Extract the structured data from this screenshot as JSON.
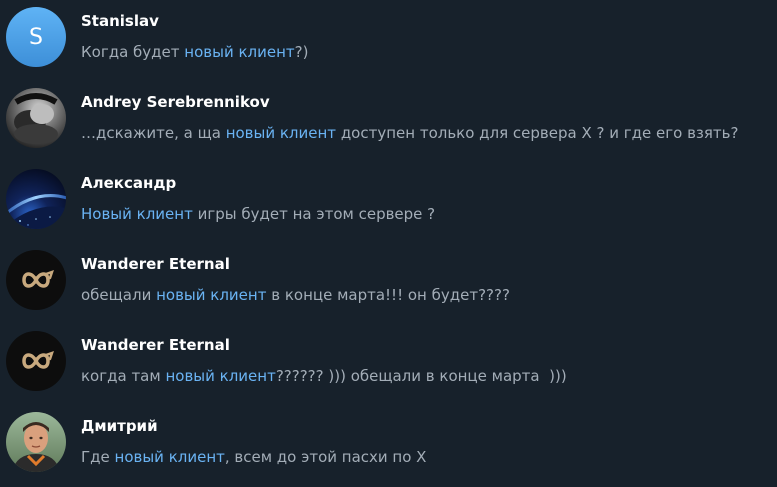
{
  "colors": {
    "background": "#17212b",
    "name": "#ffffff",
    "text": "#a3adb7",
    "highlight": "#6ab3f3",
    "avatar_blue": "#4a9ee8"
  },
  "results": [
    {
      "avatar_type": "letter",
      "avatar_letter": "S",
      "name": "Stanislav",
      "text_before": "Когда будет ",
      "highlight": "новый клиент",
      "text_after": "?)"
    },
    {
      "avatar_type": "photo-bw-portrait",
      "name": "Andrey Serebrennikov",
      "text_before": "…дскажите, а ща ",
      "highlight": "новый клиент",
      "text_after": " доступен только для сервера Х ? и где его взять?"
    },
    {
      "avatar_type": "photo-planet",
      "name": "Александр",
      "text_before": "",
      "highlight": "Новый клиент",
      "text_after": " игры будет на этом сервере ?"
    },
    {
      "avatar_type": "infinity-logo",
      "name": "Wanderer Eternal",
      "text_before": "обещали ",
      "highlight": "новый клиент",
      "text_after": " в конце марта!!! он будет????"
    },
    {
      "avatar_type": "infinity-logo",
      "name": "Wanderer Eternal",
      "text_before": "когда там ",
      "highlight": "новый клиент",
      "text_after": "?????? ))) обещали в конце марта  )))"
    },
    {
      "avatar_type": "photo-man",
      "name": "Дмитрий",
      "text_before": "Где ",
      "highlight": "новый клиент",
      "text_after": ", всем до этой пасхи по Х"
    }
  ]
}
